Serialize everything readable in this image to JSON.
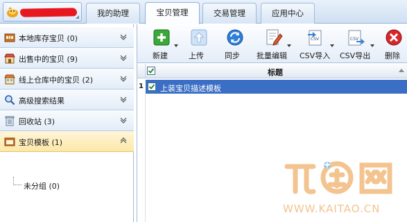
{
  "top_tabs": [
    {
      "label": "我的助理",
      "active": false
    },
    {
      "label": "宝贝管理",
      "active": true
    },
    {
      "label": "交易管理",
      "active": false
    },
    {
      "label": "应用中心",
      "active": false
    }
  ],
  "sidebar": {
    "items": [
      {
        "label": "本地库存宝贝 (0)",
        "icon": "warehouse-icon",
        "chevron": "chevron-down-icon",
        "active": false
      },
      {
        "label": "出售中的宝贝 (9)",
        "icon": "store-icon",
        "chevron": "chevron-down-icon",
        "active": false
      },
      {
        "label": "线上仓库中的宝贝 (2)",
        "icon": "online-store-icon",
        "chevron": "chevron-down-icon",
        "active": false
      },
      {
        "label": "高级搜索结果",
        "icon": "search-icon",
        "chevron": "chevron-down-icon",
        "active": false
      },
      {
        "label": "回收站 (3)",
        "icon": "trash-icon",
        "chevron": "chevron-down-icon",
        "active": false
      },
      {
        "label": "宝贝模板 (1)",
        "icon": "template-icon",
        "chevron": "chevron-up-icon",
        "active": true
      }
    ],
    "tree_child": "未分组 (0)"
  },
  "toolbar": {
    "buttons": [
      {
        "label": "新建",
        "icon": "add-icon",
        "dropdown": true
      },
      {
        "label": "上传",
        "icon": "upload-icon",
        "dropdown": false
      },
      {
        "label": "同步",
        "icon": "sync-icon",
        "dropdown": false
      },
      {
        "label": "批量编辑",
        "icon": "batch-edit-icon",
        "dropdown": true
      },
      {
        "label": "CSV导入",
        "icon": "csv-import-icon",
        "dropdown": true
      },
      {
        "label": "CSV导出",
        "icon": "csv-export-icon",
        "dropdown": true
      },
      {
        "label": "删除",
        "icon": "delete-icon",
        "dropdown": false
      }
    ]
  },
  "grid": {
    "header": {
      "title": "标题",
      "checked": true
    },
    "rows": [
      {
        "num": "1",
        "title": "上装宝贝描述模板",
        "checked": true,
        "selected": true
      }
    ]
  },
  "watermark": {
    "logo": "开淘网",
    "url": "WWW.KAITAO.CN"
  },
  "colors": {
    "selection": "#3a6fc5",
    "active_sidebar": "#fde8a8",
    "tab_border": "#8fb0d8",
    "watermark": "#f3c48f"
  }
}
